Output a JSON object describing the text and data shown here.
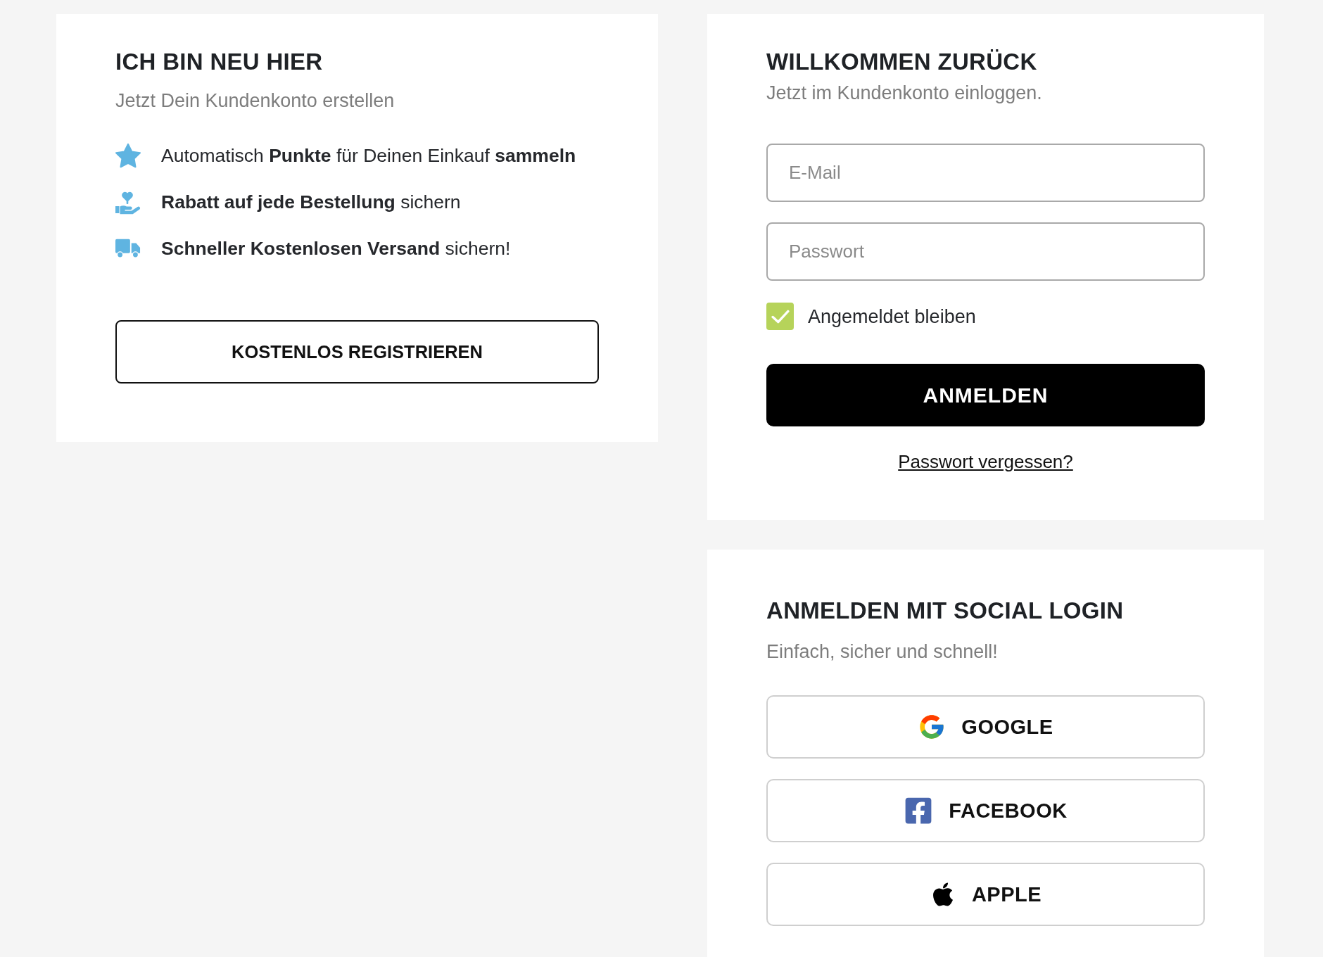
{
  "register": {
    "title": "ICH BIN NEU HIER",
    "subtitle": "Jetzt Dein Kundenkonto erstellen",
    "benefits": [
      {
        "kind": "star",
        "text": "Automatisch **Punkte** für Deinen Einkauf **sammeln**"
      },
      {
        "kind": "hand",
        "text": "**Rabatt auf jede Bestellung** sichern"
      },
      {
        "kind": "truck",
        "text": "**Schneller Kostenlosen Versand** sichern!"
      }
    ],
    "button": "KOSTENLOS REGISTRIEREN"
  },
  "login": {
    "title": "WILLKOMMEN ZURÜCK",
    "subtitle": "Jetzt im Kundenkonto einloggen.",
    "fields": [
      {
        "placeholder": "E-Mail"
      },
      {
        "placeholder": "Passwort"
      }
    ],
    "remember": {
      "label": "Angemeldet bleiben",
      "checked": true
    },
    "submit": "ANMELDEN",
    "forgot_link": "Passwort vergessen?"
  },
  "social": {
    "title": "ANMELDEN MIT SOCIAL LOGIN",
    "subtitle": "Einfach, sicher und schnell!",
    "providers": [
      {
        "kind": "google",
        "label": "GOOGLE"
      },
      {
        "kind": "facebook",
        "label": "FACEBOOK"
      },
      {
        "kind": "apple",
        "label": "APPLE"
      }
    ]
  }
}
